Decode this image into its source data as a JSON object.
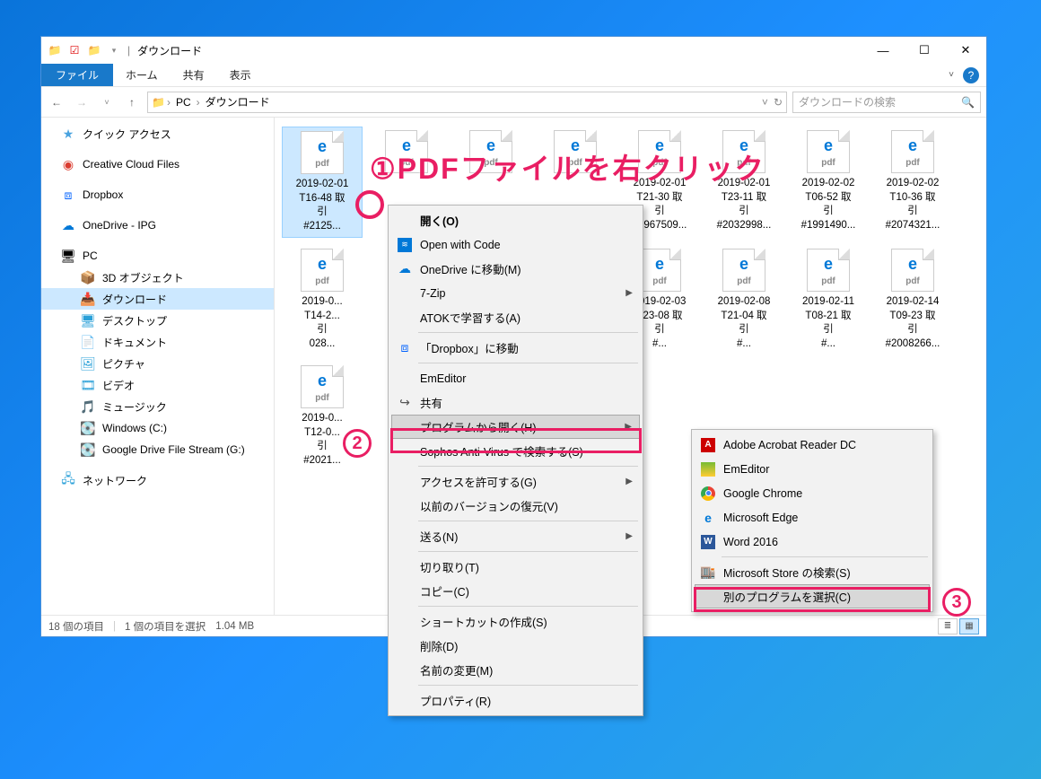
{
  "window": {
    "title": "ダウンロード",
    "minimize": "—",
    "maximize": "☐",
    "close": "✕"
  },
  "ribbon": {
    "file": "ファイル",
    "tabs": [
      "ホーム",
      "共有",
      "表示"
    ]
  },
  "addr": {
    "crumbs": [
      "PC",
      "ダウンロード"
    ],
    "refresh": "↻"
  },
  "search": {
    "placeholder": "ダウンロードの検索"
  },
  "sidebar": {
    "quick": "クイック アクセス",
    "ccf": "Creative Cloud Files",
    "dropbox": "Dropbox",
    "onedrive": "OneDrive - IPG",
    "pc": "PC",
    "pc_children": [
      "3D オブジェクト",
      "ダウンロード",
      "デスクトップ",
      "ドキュメント",
      "ピクチャ",
      "ビデオ",
      "ミュージック",
      "Windows (C:)",
      "Google Drive File Stream (G:)"
    ],
    "network": "ネットワーク"
  },
  "files": [
    {
      "name": "2019-02-01\nT16-48 取\n引\n#2125...",
      "pdf": "pdf"
    },
    {
      "name": "",
      "pdf": "pdf"
    },
    {
      "name": "",
      "pdf": "pdf"
    },
    {
      "name": "",
      "pdf": "pdf"
    },
    {
      "name": "2019-02-01\nT21-30 取\n引\n#1967509...",
      "pdf": "pdf"
    },
    {
      "name": "2019-02-01\nT23-11 取\n引\n#2032998...",
      "pdf": "pdf"
    },
    {
      "name": "2019-02-02\nT06-52 取\n引\n#1991490...",
      "pdf": "pdf"
    },
    {
      "name": "2019-02-02\nT10-36 取\n引\n#2074321...",
      "pdf": "pdf"
    },
    {
      "name": "2019-0...\nT14-2...\n引\n028...",
      "pdf": "pdf"
    },
    {
      "name": "2019-02-03\nT23-08 取\n引\n#...",
      "pdf": "pdf"
    },
    {
      "name": "2019-02-08\nT21-04 取\n引\n#...",
      "pdf": "pdf"
    },
    {
      "name": "2019-02-11\nT08-21 取\n引\n#...",
      "pdf": "pdf"
    },
    {
      "name": "2019-02-14\nT09-23 取\n引\n#2008266...",
      "pdf": "pdf"
    },
    {
      "name": "2019-0...\nT12-0...\n引\n#2021...",
      "pdf": "pdf"
    }
  ],
  "status": {
    "count": "18 個の項目",
    "selected": "1 個の項目を選択",
    "size": "1.04 MB"
  },
  "context_menu": {
    "items": [
      {
        "label": "開く(O)",
        "bold": true
      },
      {
        "label": "Open with Code",
        "icon": "vscode"
      },
      {
        "label": "OneDrive に移動(M)",
        "icon": "cloud"
      },
      {
        "label": "7-Zip",
        "sub": true
      },
      {
        "label": "ATOKで学習する(A)"
      },
      {
        "sep": true
      },
      {
        "label": "「Dropbox」に移動",
        "icon": "dropbox"
      },
      {
        "sep": true
      },
      {
        "label": "EmEditor"
      },
      {
        "label": "共有",
        "icon": "share"
      },
      {
        "label": "プログラムから開く(H)",
        "sub": true,
        "hover": true
      },
      {
        "label": "Sophos Anti-Virus で検索する(S)"
      },
      {
        "sep": true
      },
      {
        "label": "アクセスを許可する(G)",
        "sub": true
      },
      {
        "label": "以前のバージョンの復元(V)"
      },
      {
        "sep": true
      },
      {
        "label": "送る(N)",
        "sub": true
      },
      {
        "sep": true
      },
      {
        "label": "切り取り(T)"
      },
      {
        "label": "コピー(C)"
      },
      {
        "sep": true
      },
      {
        "label": "ショートカットの作成(S)"
      },
      {
        "label": "削除(D)"
      },
      {
        "label": "名前の変更(M)"
      },
      {
        "sep": true
      },
      {
        "label": "プロパティ(R)"
      }
    ]
  },
  "submenu": {
    "items": [
      {
        "label": "Adobe Acrobat Reader DC",
        "icon": "acrobat"
      },
      {
        "label": "EmEditor",
        "icon": "emeditor"
      },
      {
        "label": "Google Chrome",
        "icon": "chrome"
      },
      {
        "label": "Microsoft Edge",
        "icon": "edge"
      },
      {
        "label": "Word 2016",
        "icon": "word"
      },
      {
        "sep": true
      },
      {
        "label": "Microsoft Store の検索(S)",
        "icon": "store"
      },
      {
        "label": "別のプログラムを選択(C)",
        "hover": true
      }
    ]
  },
  "overlays": {
    "callout1": "①PDFファイルを右クリック",
    "num2": "2",
    "num3": "3"
  }
}
